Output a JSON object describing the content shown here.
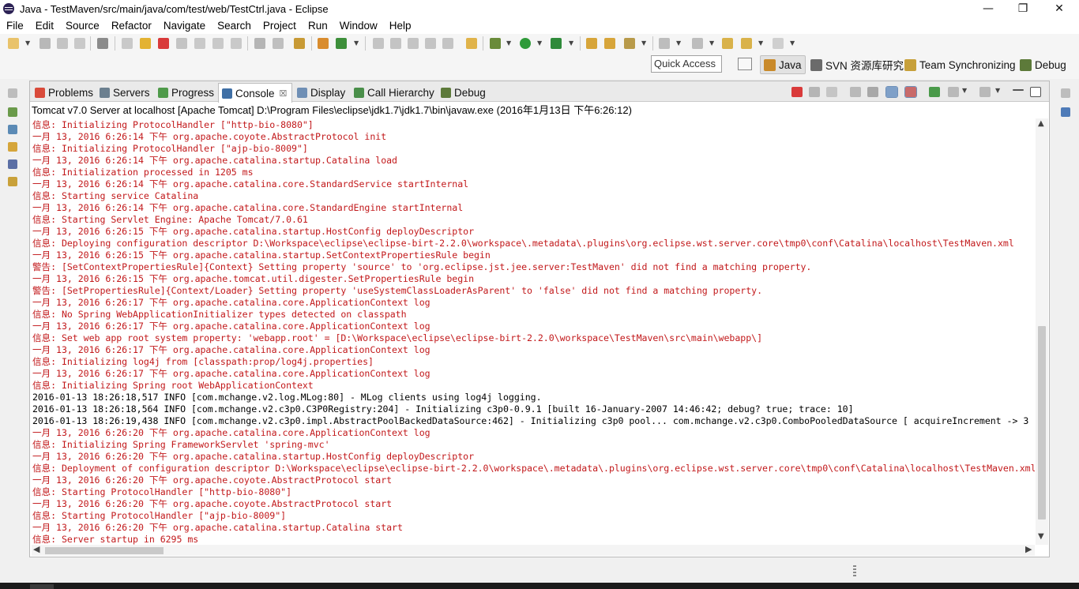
{
  "window": {
    "title": "Java - TestMaven/src/main/java/com/test/web/TestCtrl.java - Eclipse",
    "minimize_glyph": "—",
    "restore_glyph": "❐",
    "close_glyph": "✕"
  },
  "menu": {
    "items": [
      "File",
      "Edit",
      "Source",
      "Refactor",
      "Navigate",
      "Search",
      "Project",
      "Run",
      "Window",
      "Help"
    ]
  },
  "toolbar": {
    "quick_access_placeholder": "Quick Access",
    "perspectives": [
      {
        "label": "Java",
        "icon": "java-perspective-icon",
        "active": true
      },
      {
        "label": "SVN 资源库研究",
        "icon": "svn-perspective-icon",
        "active": false
      },
      {
        "label": "Team Synchronizing",
        "icon": "team-sync-icon",
        "active": false
      },
      {
        "label": "Debug",
        "icon": "debug-perspective-icon",
        "active": false
      }
    ]
  },
  "view": {
    "tabs": [
      {
        "label": "Problems",
        "icon": "problems-icon",
        "active": false
      },
      {
        "label": "Servers",
        "icon": "servers-icon",
        "active": false
      },
      {
        "label": "Progress",
        "icon": "progress-icon",
        "active": false
      },
      {
        "label": "Console",
        "icon": "console-icon",
        "active": true,
        "close": "☒"
      },
      {
        "label": "Display",
        "icon": "display-icon",
        "active": false
      },
      {
        "label": "Call Hierarchy",
        "icon": "call-hierarchy-icon",
        "active": false
      },
      {
        "label": "Debug",
        "icon": "debug-icon",
        "active": false
      }
    ],
    "process_label": "Tomcat v7.0 Server at localhost [Apache Tomcat] D:\\Program Files\\eclipse\\jdk1.7\\jdk1.7\\bin\\javaw.exe (2016年1月13日 下午6:26:12)"
  },
  "console": {
    "lines": [
      {
        "t": "信息: Initializing ProtocolHandler [\"http-bio-8080\"]",
        "k": "err"
      },
      {
        "t": "一月 13, 2016 6:26:14 下午 org.apache.coyote.AbstractProtocol init",
        "k": "err"
      },
      {
        "t": "信息: Initializing ProtocolHandler [\"ajp-bio-8009\"]",
        "k": "err"
      },
      {
        "t": "一月 13, 2016 6:26:14 下午 org.apache.catalina.startup.Catalina load",
        "k": "err"
      },
      {
        "t": "信息: Initialization processed in 1205 ms",
        "k": "err"
      },
      {
        "t": "一月 13, 2016 6:26:14 下午 org.apache.catalina.core.StandardService startInternal",
        "k": "err"
      },
      {
        "t": "信息: Starting service Catalina",
        "k": "err"
      },
      {
        "t": "一月 13, 2016 6:26:14 下午 org.apache.catalina.core.StandardEngine startInternal",
        "k": "err"
      },
      {
        "t": "信息: Starting Servlet Engine: Apache Tomcat/7.0.61",
        "k": "err"
      },
      {
        "t": "一月 13, 2016 6:26:15 下午 org.apache.catalina.startup.HostConfig deployDescriptor",
        "k": "err"
      },
      {
        "t": "信息: Deploying configuration descriptor D:\\Workspace\\eclipse\\eclipse-birt-2.2.0\\workspace\\.metadata\\.plugins\\org.eclipse.wst.server.core\\tmp0\\conf\\Catalina\\localhost\\TestMaven.xml",
        "k": "err"
      },
      {
        "t": "一月 13, 2016 6:26:15 下午 org.apache.catalina.startup.SetContextPropertiesRule begin",
        "k": "err"
      },
      {
        "t": "警告: [SetContextPropertiesRule]{Context} Setting property 'source' to 'org.eclipse.jst.jee.server:TestMaven' did not find a matching property.",
        "k": "err"
      },
      {
        "t": "一月 13, 2016 6:26:15 下午 org.apache.tomcat.util.digester.SetPropertiesRule begin",
        "k": "err"
      },
      {
        "t": "警告: [SetPropertiesRule]{Context/Loader} Setting property 'useSystemClassLoaderAsParent' to 'false' did not find a matching property.",
        "k": "err"
      },
      {
        "t": "一月 13, 2016 6:26:17 下午 org.apache.catalina.core.ApplicationContext log",
        "k": "err"
      },
      {
        "t": "信息: No Spring WebApplicationInitializer types detected on classpath",
        "k": "err"
      },
      {
        "t": "一月 13, 2016 6:26:17 下午 org.apache.catalina.core.ApplicationContext log",
        "k": "err"
      },
      {
        "t": "信息: Set web app root system property: 'webapp.root' = [D:\\Workspace\\eclipse\\eclipse-birt-2.2.0\\workspace\\TestMaven\\src\\main\\webapp\\]",
        "k": "err"
      },
      {
        "t": "一月 13, 2016 6:26:17 下午 org.apache.catalina.core.ApplicationContext log",
        "k": "err"
      },
      {
        "t": "信息: Initializing log4j from [classpath:prop/log4j.properties]",
        "k": "err"
      },
      {
        "t": "一月 13, 2016 6:26:17 下午 org.apache.catalina.core.ApplicationContext log",
        "k": "err"
      },
      {
        "t": "信息: Initializing Spring root WebApplicationContext",
        "k": "err"
      },
      {
        "t": "2016-01-13 18:26:18,517 INFO [com.mchange.v2.log.MLog:80] - MLog clients using log4j logging.",
        "k": "out"
      },
      {
        "t": "2016-01-13 18:26:18,564 INFO [com.mchange.v2.c3p0.C3P0Registry:204] - Initializing c3p0-0.9.1 [built 16-January-2007 14:46:42; debug? true; trace: 10]",
        "k": "out"
      },
      {
        "t": "2016-01-13 18:26:19,438 INFO [com.mchange.v2.c3p0.impl.AbstractPoolBackedDataSource:462] - Initializing c3p0 pool... com.mchange.v2.c3p0.ComboPooledDataSource [ acquireIncrement -> 3",
        "k": "out"
      },
      {
        "t": "一月 13, 2016 6:26:20 下午 org.apache.catalina.core.ApplicationContext log",
        "k": "err"
      },
      {
        "t": "信息: Initializing Spring FrameworkServlet 'spring-mvc'",
        "k": "err"
      },
      {
        "t": "一月 13, 2016 6:26:20 下午 org.apache.catalina.startup.HostConfig deployDescriptor",
        "k": "err"
      },
      {
        "t": "信息: Deployment of configuration descriptor D:\\Workspace\\eclipse\\eclipse-birt-2.2.0\\workspace\\.metadata\\.plugins\\org.eclipse.wst.server.core\\tmp0\\conf\\Catalina\\localhost\\TestMaven.xml",
        "k": "err"
      },
      {
        "t": "一月 13, 2016 6:26:20 下午 org.apache.coyote.AbstractProtocol start",
        "k": "err"
      },
      {
        "t": "信息: Starting ProtocolHandler [\"http-bio-8080\"]",
        "k": "err"
      },
      {
        "t": "一月 13, 2016 6:26:20 下午 org.apache.coyote.AbstractProtocol start",
        "k": "err"
      },
      {
        "t": "信息: Starting ProtocolHandler [\"ajp-bio-8009\"]",
        "k": "err"
      },
      {
        "t": "一月 13, 2016 6:26:20 下午 org.apache.catalina.startup.Catalina start",
        "k": "err"
      },
      {
        "t": "信息: Server startup in 6295 ms",
        "k": "err"
      }
    ]
  },
  "scroll": {
    "up": "▲",
    "down": "▼",
    "left": "◀",
    "right": "▶"
  },
  "colors": {
    "stderr": "#c2191b",
    "stdout": "#000000",
    "terminate": "#e23b3b",
    "accent_green": "#2f9a3a"
  }
}
